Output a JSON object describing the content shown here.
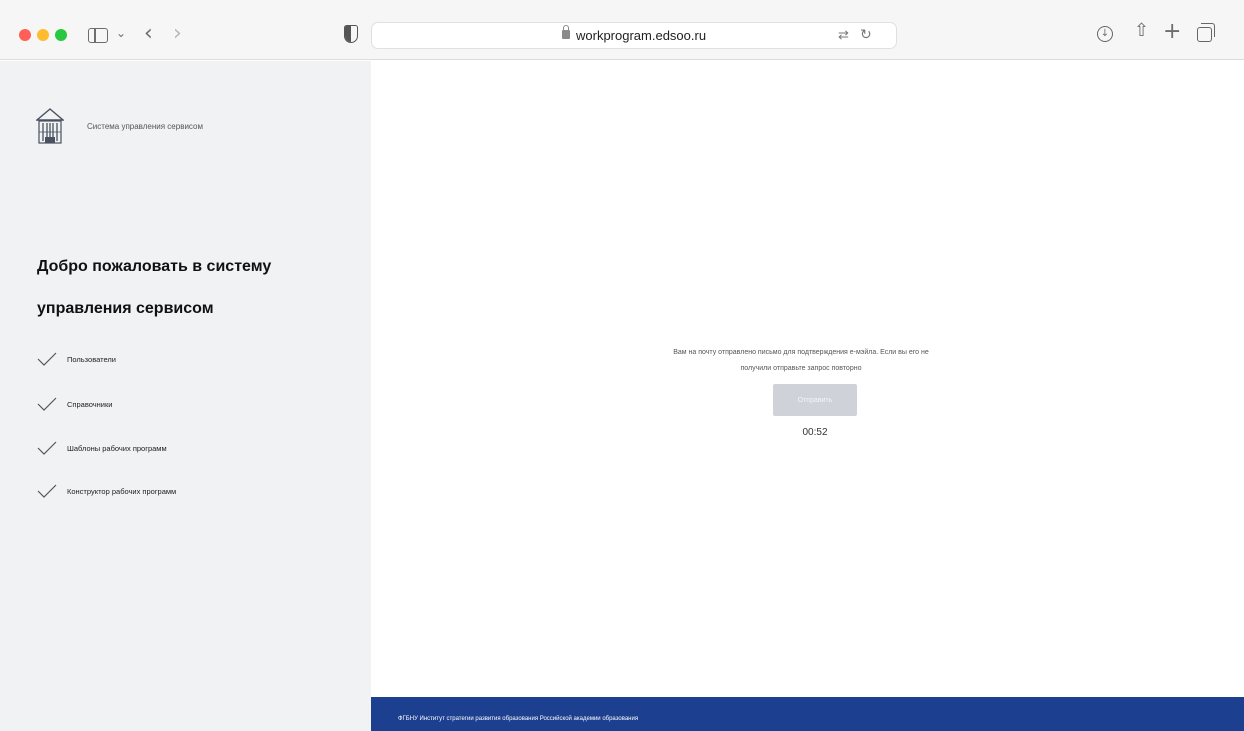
{
  "browser": {
    "url": "workprogram.edsoo.ru"
  },
  "sidebar": {
    "brand": "Система управления сервисом",
    "welcome_title": "Добро пожаловать в систему управления сервисом",
    "features": [
      {
        "label": "Пользователи"
      },
      {
        "label": "Справочники"
      },
      {
        "label": "Шаблоны рабочих программ"
      },
      {
        "label": "Конструктор рабочих программ"
      }
    ]
  },
  "main": {
    "message_line1": "Вам на почту отправлено письмо для подтверждения е-мэйла. Если вы его не",
    "message_line2": "получили отправьте запрос повторно",
    "send_label": "Отправить",
    "timer": "00:52"
  },
  "footer": {
    "text": "ФГБНУ Институт стратегии развития образования Российской академии образования"
  },
  "colors": {
    "footer_bg": "#1c3f8f",
    "sidebar_bg": "#f1f2f4",
    "button_disabled": "#cfd2d9"
  }
}
